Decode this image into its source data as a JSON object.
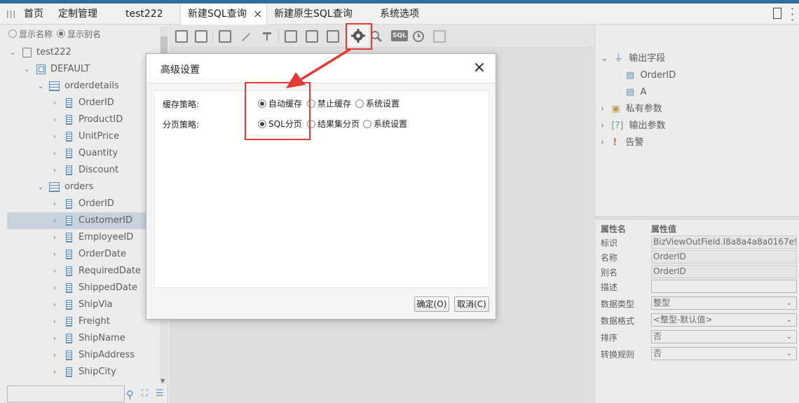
{
  "tabs": {
    "home": "首页",
    "custom": "定制管理",
    "test222": "test222",
    "new_sql": "新建SQL查询",
    "new_native_sql": "新建原生SQL查询",
    "system_options": "系统选项",
    "close": "×"
  },
  "left": {
    "show_name": "显示名称",
    "show_alias": "显示别名",
    "tree": {
      "db": "test222",
      "schema": "DEFAULT",
      "table1": {
        "name": "orderdetails",
        "fields": [
          "OrderID",
          "ProductID",
          "UnitPrice",
          "Quantity",
          "Discount"
        ]
      },
      "table2": {
        "name": "orders",
        "fields": [
          "OrderID",
          "CustomerID",
          "EmployeeID",
          "OrderDate",
          "RequiredDate",
          "ShippedDate",
          "ShipVia",
          "Freight",
          "ShipName",
          "ShipAddress",
          "ShipCity"
        ],
        "selected": "CustomerID"
      }
    }
  },
  "right": {
    "tree": {
      "output_fields": "输出字段",
      "field1": "OrderID",
      "field2": "A",
      "private_params": "私有参数",
      "output_params": "输出参数",
      "alerts": "告警"
    },
    "props": {
      "header_name": "属性名",
      "header_value": "属性值",
      "rows": [
        {
          "label": "标识",
          "value": "BizViewOutField.I8a8a4a8a0167e9"
        },
        {
          "label": "名称",
          "value": "OrderID"
        },
        {
          "label": "别名",
          "value": "OrderID"
        },
        {
          "label": "描述",
          "value": ""
        },
        {
          "label": "数据类型",
          "value": "整型"
        },
        {
          "label": "数据格式",
          "value": "<整型-默认值>"
        },
        {
          "label": "排序",
          "value": "否"
        },
        {
          "label": "转换规则",
          "value": "否"
        }
      ]
    }
  },
  "dialog": {
    "title": "高级设置",
    "close": "×",
    "cache_label": "缓存策略:",
    "cache_options": [
      "自动缓存",
      "禁止缓存",
      "系统设置"
    ],
    "paging_label": "分页策略:",
    "paging_options": [
      "SQL分页",
      "结果集分页",
      "系统设置"
    ],
    "ok": "确定(O)",
    "cancel": "取消(C)"
  },
  "toolbar": {
    "sql_badge": "SQL"
  },
  "colors": {
    "accent": "#2e6fa3",
    "highlight": "#e53935",
    "selected_row": "#c7d7e6"
  }
}
